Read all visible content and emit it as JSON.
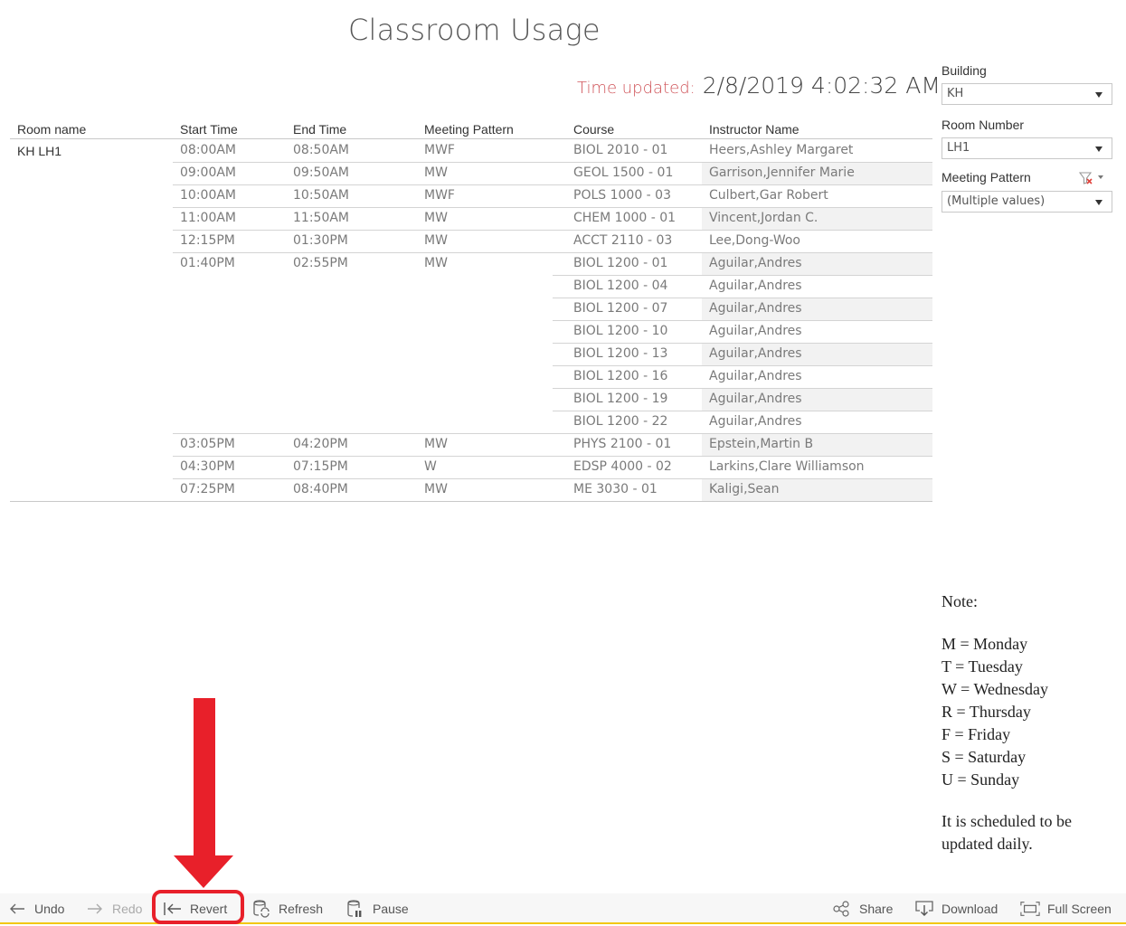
{
  "page": {
    "title": "Classroom Usage",
    "time_updated_label": "Time updated:",
    "time_updated_value": "2/8/2019 4:02:32 AM"
  },
  "colors": {
    "time_label": "#d0565b",
    "annotation": "#e8202a",
    "toolbar_accent": "#f2c811"
  },
  "table": {
    "headers": {
      "room": "Room name",
      "start": "Start Time",
      "end": "End Time",
      "pattern": "Meeting Pattern",
      "course": "Course",
      "instructor": "Instructor Name"
    },
    "room_name": "KH LH1",
    "rows": [
      {
        "start": "08:00AM",
        "end": "08:50AM",
        "pattern": "MWF",
        "course": "BIOL 2010 - 01",
        "instructor": "Heers,Ashley Margaret"
      },
      {
        "start": "09:00AM",
        "end": "09:50AM",
        "pattern": "MW",
        "course": "GEOL 1500 - 01",
        "instructor": "Garrison,Jennifer Marie"
      },
      {
        "start": "10:00AM",
        "end": "10:50AM",
        "pattern": "MWF",
        "course": "POLS 1000 - 03",
        "instructor": "Culbert,Gar Robert"
      },
      {
        "start": "11:00AM",
        "end": "11:50AM",
        "pattern": "MW",
        "course": "CHEM 1000 - 01",
        "instructor": "Vincent,Jordan C."
      },
      {
        "start": "12:15PM",
        "end": "01:30PM",
        "pattern": "MW",
        "course": "ACCT 2110 - 03",
        "instructor": "Lee,Dong-Woo"
      },
      {
        "start": "01:40PM",
        "end": "02:55PM",
        "pattern": "MW",
        "course": "BIOL 1200 - 01",
        "instructor": "Aguilar,Andres"
      },
      {
        "start": "",
        "end": "",
        "pattern": "",
        "course": "BIOL 1200 - 04",
        "instructor": "Aguilar,Andres"
      },
      {
        "start": "",
        "end": "",
        "pattern": "",
        "course": "BIOL 1200 - 07",
        "instructor": "Aguilar,Andres"
      },
      {
        "start": "",
        "end": "",
        "pattern": "",
        "course": "BIOL 1200 - 10",
        "instructor": "Aguilar,Andres"
      },
      {
        "start": "",
        "end": "",
        "pattern": "",
        "course": "BIOL 1200 - 13",
        "instructor": "Aguilar,Andres"
      },
      {
        "start": "",
        "end": "",
        "pattern": "",
        "course": "BIOL 1200 - 16",
        "instructor": "Aguilar,Andres"
      },
      {
        "start": "",
        "end": "",
        "pattern": "",
        "course": "BIOL 1200 - 19",
        "instructor": "Aguilar,Andres"
      },
      {
        "start": "",
        "end": "",
        "pattern": "",
        "course": "BIOL 1200 - 22",
        "instructor": "Aguilar,Andres"
      },
      {
        "start": "03:05PM",
        "end": "04:20PM",
        "pattern": "MW",
        "course": "PHYS 2100 - 01",
        "instructor": "Epstein,Martin B"
      },
      {
        "start": "04:30PM",
        "end": "07:15PM",
        "pattern": "W",
        "course": "EDSP 4000 - 02",
        "instructor": "Larkins,Clare Williamson"
      },
      {
        "start": "07:25PM",
        "end": "08:40PM",
        "pattern": "MW",
        "course": "ME 3030 - 01",
        "instructor": "Kaligi,Sean"
      }
    ]
  },
  "filters": {
    "building": {
      "label": "Building",
      "value": "KH"
    },
    "room_number": {
      "label": "Room Number",
      "value": "LH1"
    },
    "meeting_pattern": {
      "label": "Meeting Pattern",
      "value": "(Multiple values)"
    }
  },
  "note": {
    "heading": "Note:",
    "legend": [
      "M = Monday",
      "T = Tuesday",
      "W = Wednesday",
      "R = Thursday",
      "F = Friday",
      "S = Saturday",
      "U = Sunday"
    ],
    "footer_line1": "It is scheduled to be",
    "footer_line2": "updated daily."
  },
  "toolbar": {
    "undo": "Undo",
    "redo": "Redo",
    "revert": "Revert",
    "refresh": "Refresh",
    "pause": "Pause",
    "share": "Share",
    "download": "Download",
    "full_screen": "Full Screen"
  }
}
